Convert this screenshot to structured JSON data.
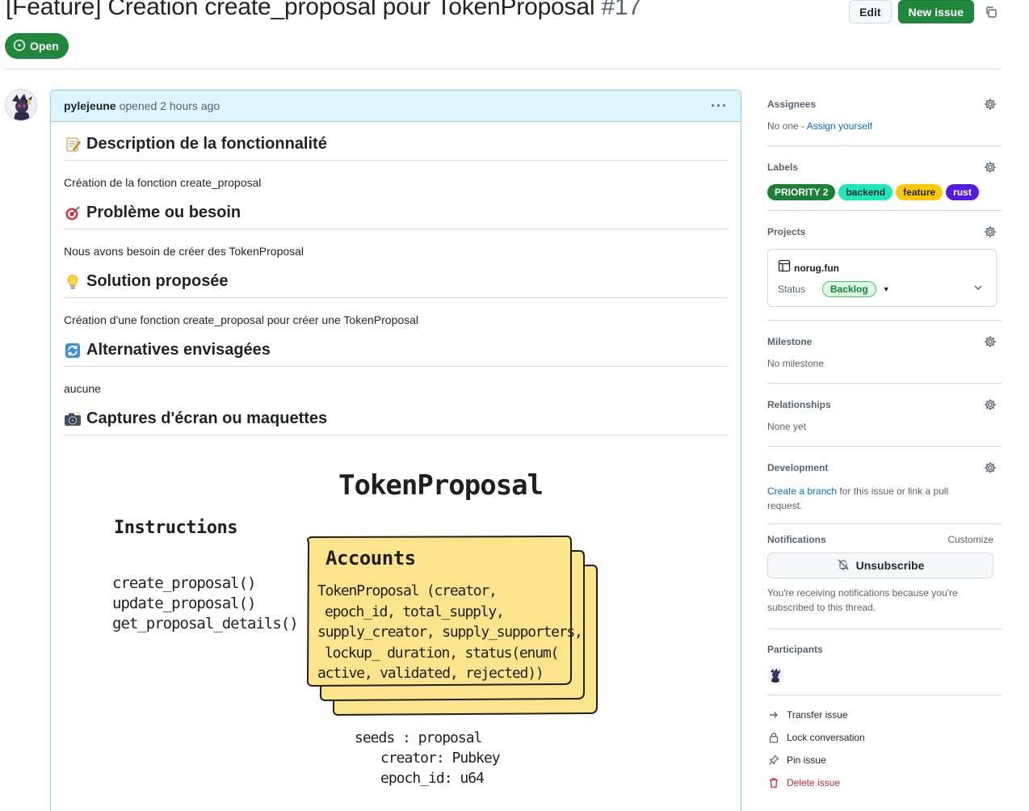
{
  "issue": {
    "title": "[Feature] Creation create_proposal pour TokenProposal",
    "number": "#17",
    "state": "Open",
    "buttons": {
      "edit": "Edit",
      "new_issue": "New issue"
    }
  },
  "comment": {
    "author": "pylejeune",
    "meta": "opened 2 hours ago",
    "menu": "···",
    "sections": [
      {
        "heading": "Description de la fonctionnalité",
        "icon": "memo-icon",
        "text": "Création de la fonction create_proposal"
      },
      {
        "heading": "Problème ou besoin",
        "icon": "target-icon",
        "text": "Nous avons besoin de créer des TokenProposal"
      },
      {
        "heading": "Solution proposée",
        "icon": "lightbulb-icon",
        "text": "Création d'une fonction create_proposal pour créer une TokenProposal"
      },
      {
        "heading": "Alternatives envisagées",
        "icon": "arrows-cycle-icon",
        "text": "aucune"
      },
      {
        "heading": "Captures d'écran ou maquettes",
        "icon": "camera-icon",
        "text": ""
      }
    ],
    "sketch": {
      "title": "TokenProposal",
      "instructions_label": "Instructions",
      "instructions": [
        "create_proposal()",
        "update_proposal()",
        "get_proposal_details()"
      ],
      "accounts_label": "Accounts",
      "accounts_lines": [
        "TokenProposal (creator,",
        "epoch_id, total_supply,",
        "supply_creator, supply_supporters,",
        "lockup_ duration, status(enum(",
        "active, validated, rejected))"
      ],
      "seeds_lines": [
        "seeds : proposal",
        "creator: Pubkey",
        "epoch_id: u64"
      ]
    }
  },
  "sidebar": {
    "assignees": {
      "title": "Assignees",
      "none": "No one - ",
      "assign": "Assign yourself"
    },
    "labels": {
      "title": "Labels",
      "items": [
        {
          "name": "PRIORITY 2",
          "bg": "#1a7f37",
          "fg": "#ffffff"
        },
        {
          "name": "backend",
          "bg": "#1de9b6",
          "fg": "#1f2328"
        },
        {
          "name": "feature",
          "bg": "#fbca04",
          "fg": "#1f2328"
        },
        {
          "name": "rust",
          "bg": "#5319e7",
          "fg": "#ffffff"
        }
      ]
    },
    "projects": {
      "title": "Projects",
      "name": "norug.fun",
      "status_label": "Status",
      "status_value": "Backlog"
    },
    "milestone": {
      "title": "Milestone",
      "value": "No milestone"
    },
    "relationships": {
      "title": "Relationships",
      "value": "None yet"
    },
    "development": {
      "title": "Development",
      "link": "Create a branch",
      "rest": " for this issue or link a pull request."
    },
    "notifications": {
      "title": "Notifications",
      "customize": "Customize",
      "button": "Unsubscribe",
      "note": "You're receiving notifications because you're subscribed to this thread."
    },
    "participants": {
      "title": "Participants"
    },
    "actions": [
      {
        "label": "Transfer issue",
        "icon": "arrow-right-icon"
      },
      {
        "label": "Lock conversation",
        "icon": "lock-icon"
      },
      {
        "label": "Pin issue",
        "icon": "pin-icon"
      },
      {
        "label": "Delete issue",
        "icon": "trash-icon"
      }
    ]
  }
}
